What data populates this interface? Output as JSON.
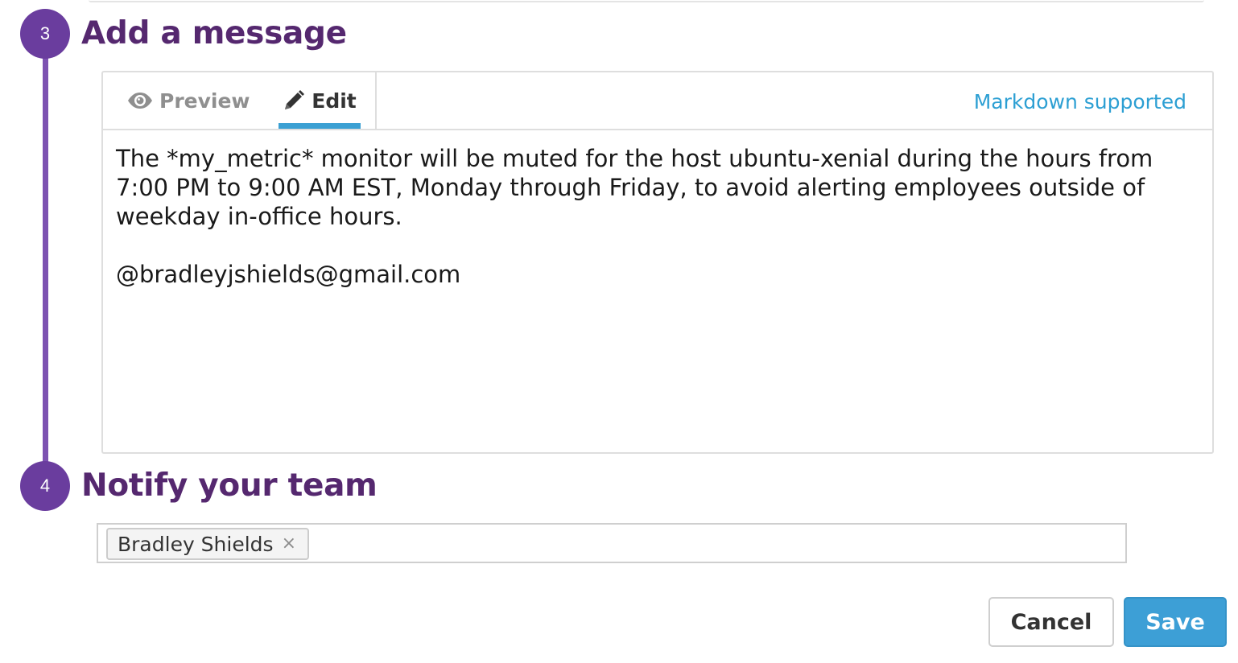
{
  "steps": {
    "message": {
      "number": "3",
      "title": "Add a message"
    },
    "notify": {
      "number": "4",
      "title": "Notify your team"
    }
  },
  "editor": {
    "tabs": {
      "preview": {
        "label": "Preview",
        "icon": "eye-icon"
      },
      "edit": {
        "label": "Edit",
        "icon": "pencil-icon",
        "active": true
      }
    },
    "markdown_link": "Markdown supported",
    "message": "The *my_metric* monitor will be muted for the host ubuntu-xenial during the hours from 7:00 PM to 9:00 AM EST, Monday through Friday, to avoid alerting employees outside of weekday in-office hours.\n\n@bradleyjshields@gmail.com"
  },
  "notify": {
    "recipients": [
      {
        "name": "Bradley Shields",
        "remove_glyph": "×"
      }
    ]
  },
  "actions": {
    "cancel_label": "Cancel",
    "save_label": "Save"
  },
  "colors": {
    "step_purple": "#6a3d9e",
    "title_purple": "#55286f",
    "link_blue": "#2c9fd3",
    "save_blue": "#3d9fd6"
  }
}
